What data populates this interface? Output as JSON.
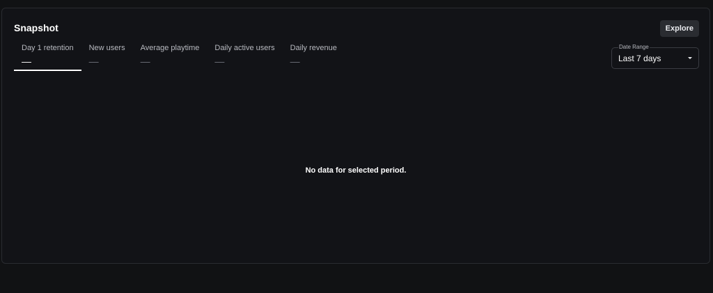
{
  "snapshot": {
    "title": "Snapshot",
    "explore_label": "Explore",
    "tabs": [
      {
        "label": "Day 1 retention",
        "value": "—"
      },
      {
        "label": "New users",
        "value": "—"
      },
      {
        "label": "Average playtime",
        "value": "—"
      },
      {
        "label": "Daily active users",
        "value": "—"
      },
      {
        "label": "Daily revenue",
        "value": "—"
      }
    ],
    "active_tab": "Day 1 retention",
    "date_range": {
      "label": "Date Range",
      "value": "Last 7 days"
    },
    "empty_message": "No data for selected period."
  }
}
